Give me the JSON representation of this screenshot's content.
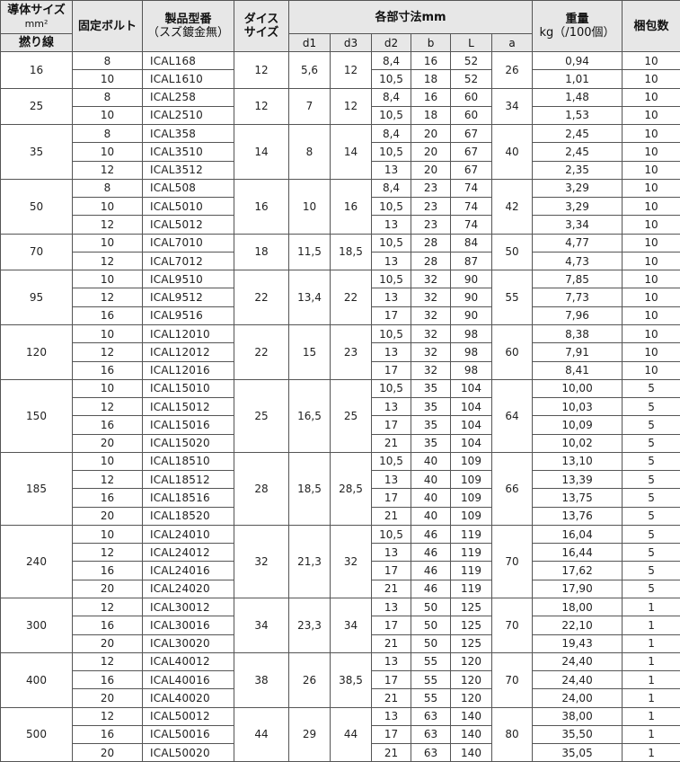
{
  "header": {
    "conductor_line1": "導体サイズ",
    "conductor_line2": "mm²",
    "stranded": "撚り線",
    "bolt": "固定ボルト",
    "model_line1": "製品型番",
    "model_line2": "（スズ鍍金無）",
    "die_line1": "ダイス",
    "die_line2": "サイズ",
    "dims": "各部寸法mm",
    "d1": "d1",
    "d3": "d3",
    "d2": "d2",
    "b": "b",
    "L": "L",
    "a": "a",
    "weight_line1": "重量",
    "weight_line2": "kg（/100個）",
    "pack": "梱包数"
  },
  "groups": [
    {
      "size": "16",
      "die": "12",
      "d1": "5,6",
      "d3": "12",
      "a": "26",
      "rows": [
        {
          "bolt": "8",
          "model": "ICAL168",
          "d2": "8,4",
          "b": "16",
          "L": "52",
          "weight": "0,94",
          "pack": "10"
        },
        {
          "bolt": "10",
          "model": "ICAL1610",
          "d2": "10,5",
          "b": "18",
          "L": "52",
          "weight": "1,01",
          "pack": "10"
        }
      ]
    },
    {
      "size": "25",
      "die": "12",
      "d1": "7",
      "d3": "12",
      "a": "34",
      "rows": [
        {
          "bolt": "8",
          "model": "ICAL258",
          "d2": "8,4",
          "b": "16",
          "L": "60",
          "weight": "1,48",
          "pack": "10"
        },
        {
          "bolt": "10",
          "model": "ICAL2510",
          "d2": "10,5",
          "b": "18",
          "L": "60",
          "weight": "1,53",
          "pack": "10"
        }
      ]
    },
    {
      "size": "35",
      "die": "14",
      "d1": "8",
      "d3": "14",
      "a": "40",
      "rows": [
        {
          "bolt": "8",
          "model": "ICAL358",
          "d2": "8,4",
          "b": "20",
          "L": "67",
          "weight": "2,45",
          "pack": "10"
        },
        {
          "bolt": "10",
          "model": "ICAL3510",
          "d2": "10,5",
          "b": "20",
          "L": "67",
          "weight": "2,45",
          "pack": "10"
        },
        {
          "bolt": "12",
          "model": "ICAL3512",
          "d2": "13",
          "b": "20",
          "L": "67",
          "weight": "2,35",
          "pack": "10"
        }
      ]
    },
    {
      "size": "50",
      "die": "16",
      "d1": "10",
      "d3": "16",
      "a": "42",
      "rows": [
        {
          "bolt": "8",
          "model": "ICAL508",
          "d2": "8,4",
          "b": "23",
          "L": "74",
          "weight": "3,29",
          "pack": "10"
        },
        {
          "bolt": "10",
          "model": "ICAL5010",
          "d2": "10,5",
          "b": "23",
          "L": "74",
          "weight": "3,29",
          "pack": "10"
        },
        {
          "bolt": "12",
          "model": "ICAL5012",
          "d2": "13",
          "b": "23",
          "L": "74",
          "weight": "3,34",
          "pack": "10"
        }
      ]
    },
    {
      "size": "70",
      "die": "18",
      "d1": "11,5",
      "d3": "18,5",
      "a": "50",
      "rows": [
        {
          "bolt": "10",
          "model": "ICAL7010",
          "d2": "10,5",
          "b": "28",
          "L": "84",
          "weight": "4,77",
          "pack": "10"
        },
        {
          "bolt": "12",
          "model": "ICAL7012",
          "d2": "13",
          "b": "28",
          "L": "87",
          "weight": "4,73",
          "pack": "10"
        }
      ]
    },
    {
      "size": "95",
      "die": "22",
      "d1": "13,4",
      "d3": "22",
      "a": "55",
      "rows": [
        {
          "bolt": "10",
          "model": "ICAL9510",
          "d2": "10,5",
          "b": "32",
          "L": "90",
          "weight": "7,85",
          "pack": "10"
        },
        {
          "bolt": "12",
          "model": "ICAL9512",
          "d2": "13",
          "b": "32",
          "L": "90",
          "weight": "7,73",
          "pack": "10"
        },
        {
          "bolt": "16",
          "model": "ICAL9516",
          "d2": "17",
          "b": "32",
          "L": "90",
          "weight": "7,96",
          "pack": "10"
        }
      ]
    },
    {
      "size": "120",
      "die": "22",
      "d1": "15",
      "d3": "23",
      "a": "60",
      "rows": [
        {
          "bolt": "10",
          "model": "ICAL12010",
          "d2": "10,5",
          "b": "32",
          "L": "98",
          "weight": "8,38",
          "pack": "10"
        },
        {
          "bolt": "12",
          "model": "ICAL12012",
          "d2": "13",
          "b": "32",
          "L": "98",
          "weight": "7,91",
          "pack": "10"
        },
        {
          "bolt": "16",
          "model": "ICAL12016",
          "d2": "17",
          "b": "32",
          "L": "98",
          "weight": "8,41",
          "pack": "10"
        }
      ]
    },
    {
      "size": "150",
      "die": "25",
      "d1": "16,5",
      "d3": "25",
      "a": "64",
      "rows": [
        {
          "bolt": "10",
          "model": "ICAL15010",
          "d2": "10,5",
          "b": "35",
          "L": "104",
          "weight": "10,00",
          "pack": "5"
        },
        {
          "bolt": "12",
          "model": "ICAL15012",
          "d2": "13",
          "b": "35",
          "L": "104",
          "weight": "10,03",
          "pack": "5"
        },
        {
          "bolt": "16",
          "model": "ICAL15016",
          "d2": "17",
          "b": "35",
          "L": "104",
          "weight": "10,09",
          "pack": "5"
        },
        {
          "bolt": "20",
          "model": "ICAL15020",
          "d2": "21",
          "b": "35",
          "L": "104",
          "weight": "10,02",
          "pack": "5"
        }
      ]
    },
    {
      "size": "185",
      "die": "28",
      "d1": "18,5",
      "d3": "28,5",
      "a": "66",
      "rows": [
        {
          "bolt": "10",
          "model": "ICAL18510",
          "d2": "10,5",
          "b": "40",
          "L": "109",
          "weight": "13,10",
          "pack": "5"
        },
        {
          "bolt": "12",
          "model": "ICAL18512",
          "d2": "13",
          "b": "40",
          "L": "109",
          "weight": "13,39",
          "pack": "5"
        },
        {
          "bolt": "16",
          "model": "ICAL18516",
          "d2": "17",
          "b": "40",
          "L": "109",
          "weight": "13,75",
          "pack": "5"
        },
        {
          "bolt": "20",
          "model": "ICAL18520",
          "d2": "21",
          "b": "40",
          "L": "109",
          "weight": "13,76",
          "pack": "5"
        }
      ]
    },
    {
      "size": "240",
      "die": "32",
      "d1": "21,3",
      "d3": "32",
      "a": "70",
      "rows": [
        {
          "bolt": "10",
          "model": "ICAL24010",
          "d2": "10,5",
          "b": "46",
          "L": "119",
          "weight": "16,04",
          "pack": "5"
        },
        {
          "bolt": "12",
          "model": "ICAL24012",
          "d2": "13",
          "b": "46",
          "L": "119",
          "weight": "16,44",
          "pack": "5"
        },
        {
          "bolt": "16",
          "model": "ICAL24016",
          "d2": "17",
          "b": "46",
          "L": "119",
          "weight": "17,62",
          "pack": "5"
        },
        {
          "bolt": "20",
          "model": "ICAL24020",
          "d2": "21",
          "b": "46",
          "L": "119",
          "weight": "17,90",
          "pack": "5"
        }
      ]
    },
    {
      "size": "300",
      "die": "34",
      "d1": "23,3",
      "d3": "34",
      "a": "70",
      "rows": [
        {
          "bolt": "12",
          "model": "ICAL30012",
          "d2": "13",
          "b": "50",
          "L": "125",
          "weight": "18,00",
          "pack": "1"
        },
        {
          "bolt": "16",
          "model": "ICAL30016",
          "d2": "17",
          "b": "50",
          "L": "125",
          "weight": "22,10",
          "pack": "1"
        },
        {
          "bolt": "20",
          "model": "ICAL30020",
          "d2": "21",
          "b": "50",
          "L": "125",
          "weight": "19,43",
          "pack": "1"
        }
      ]
    },
    {
      "size": "400",
      "die": "38",
      "d1": "26",
      "d3": "38,5",
      "a": "70",
      "rows": [
        {
          "bolt": "12",
          "model": "ICAL40012",
          "d2": "13",
          "b": "55",
          "L": "120",
          "weight": "24,40",
          "pack": "1"
        },
        {
          "bolt": "16",
          "model": "ICAL40016",
          "d2": "17",
          "b": "55",
          "L": "120",
          "weight": "24,40",
          "pack": "1"
        },
        {
          "bolt": "20",
          "model": "ICAL40020",
          "d2": "21",
          "b": "55",
          "L": "120",
          "weight": "24,00",
          "pack": "1"
        }
      ]
    },
    {
      "size": "500",
      "die": "44",
      "d1": "29",
      "d3": "44",
      "a": "80",
      "rows": [
        {
          "bolt": "12",
          "model": "ICAL50012",
          "d2": "13",
          "b": "63",
          "L": "140",
          "weight": "38,00",
          "pack": "1"
        },
        {
          "bolt": "16",
          "model": "ICAL50016",
          "d2": "17",
          "b": "63",
          "L": "140",
          "weight": "35,50",
          "pack": "1"
        },
        {
          "bolt": "20",
          "model": "ICAL50020",
          "d2": "21",
          "b": "63",
          "L": "140",
          "weight": "35,05",
          "pack": "1"
        }
      ]
    }
  ]
}
